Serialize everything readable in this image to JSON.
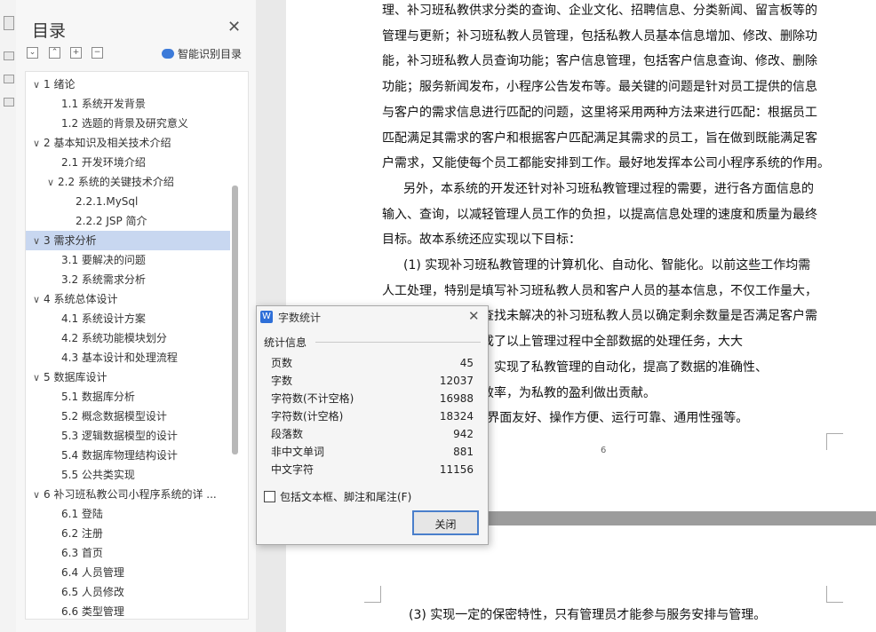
{
  "toc": {
    "title": "目录",
    "smart_toc_label": "智能识别目录",
    "items": [
      {
        "label": "1 绪论",
        "level": 1,
        "expanded": true
      },
      {
        "label": "1.1 系统开发背景",
        "level": 2
      },
      {
        "label": "1.2 选题的背景及研究意义",
        "level": 2
      },
      {
        "label": "2 基本知识及相关技术介绍",
        "level": 1,
        "expanded": true
      },
      {
        "label": "2.1 开发环境介绍",
        "level": 2
      },
      {
        "label": "2.2 系统的关键技术介绍",
        "level": 2,
        "expanded": true
      },
      {
        "label": "2.2.1.MySql",
        "level": 3
      },
      {
        "label": "2.2.2 JSP 简介",
        "level": 3
      },
      {
        "label": "3 需求分析",
        "level": 1,
        "expanded": true,
        "selected": true
      },
      {
        "label": "3.1  要解决的问题",
        "level": 2
      },
      {
        "label": "3.2 系统需求分析",
        "level": 2
      },
      {
        "label": "4 系统总体设计",
        "level": 1,
        "expanded": true
      },
      {
        "label": "4.1 系统设计方案",
        "level": 2
      },
      {
        "label": "4.2 系统功能模块划分",
        "level": 2
      },
      {
        "label": "4.3  基本设计和处理流程",
        "level": 2
      },
      {
        "label": "5 数据库设计",
        "level": 1,
        "expanded": true
      },
      {
        "label": "5.1 数据库分析",
        "level": 2
      },
      {
        "label": "5.2 概念数据模型设计",
        "level": 2
      },
      {
        "label": "5.3 逻辑数据模型的设计",
        "level": 2
      },
      {
        "label": "5.4 数据库物理结构设计",
        "level": 2
      },
      {
        "label": "5.5 公共类实现",
        "level": 2
      },
      {
        "label": "6 补习班私教公司小程序系统的详 ...",
        "level": 1,
        "expanded": true
      },
      {
        "label": "6.1  登陆",
        "level": 2
      },
      {
        "label": "6.2  注册",
        "level": 2
      },
      {
        "label": "6.3  首页",
        "level": 2
      },
      {
        "label": "6.4  人员管理",
        "level": 2
      },
      {
        "label": "6.5 人员修改",
        "level": 2
      },
      {
        "label": "6.6 类型管理",
        "level": 2
      }
    ]
  },
  "document": {
    "lines": [
      "理、补习班私教供求分类的查询、企业文化、招聘信息、分类新闻、留言板等的",
      "管理与更新；补习班私教人员管理，包括私教人员基本信息增加、修改、删除功",
      "能，补习班私教人员查询功能；客户信息管理，包括客户信息查询、修改、删除",
      "功能；服务新闻发布，小程序公告发布等。最关键的问题是针对员工提供的信息",
      "与客户的需求信息进行匹配的问题，这里将采用两种方法来进行匹配：根据员工",
      "匹配满足其需求的客户和根据客户匹配满足其需求的员工，旨在做到既能满足客",
      "户需求，又能使每个员工都能安排到工作。最好地发挥本公司小程序系统的作用。",
      "    另外，本系统的开发还针对补习班私教管理过程的需要，进行各方面信息的",
      "输入、查询，以减轻管理人员工作的负担，以提高信息处理的速度和质量为最终",
      "目标。故本系统还应实现以下目标：",
      "    (1) 实现补习班私教管理的计算机化、自动化、智能化。以前这些工作均需",
      "人工处理，特别是填写补习班私教人员和客户人员的基本信息，不仅工作量大，",
      "容易出错，且还需查找未解决的补习班私教人员以确定剩余数量是否满足客户需",
      "求，系统的应用完成了以上管理过程中全部数据的处理任务，大大",
      "减轻了员的工作量，实现了私教管理的自动化，提高了数据的准确性、",
      "时性，提高了服务效率，为私教的盈利做出贡献。",
      "    (2) 功能齐全、界面友好、操作方便、运行可靠、通用性强等。"
    ],
    "page_number": "6",
    "page2_line": "(3) 实现一定的保密特性，只有管理员才能参与服务安排与管理。"
  },
  "dialog": {
    "title": "字数统计",
    "section_label": "统计信息",
    "stats": [
      {
        "label": "页数",
        "value": "45"
      },
      {
        "label": "字数",
        "value": "12037"
      },
      {
        "label": "字符数(不计空格)",
        "value": "16988"
      },
      {
        "label": "字符数(计空格)",
        "value": "18324"
      },
      {
        "label": "段落数",
        "value": "942"
      },
      {
        "label": "非中文单词",
        "value": "881"
      },
      {
        "label": "中文字符",
        "value": "11156"
      }
    ],
    "checkbox_label": "包括文本框、脚注和尾注(F)",
    "checkbox_checked": false,
    "close_label": "关闭"
  }
}
